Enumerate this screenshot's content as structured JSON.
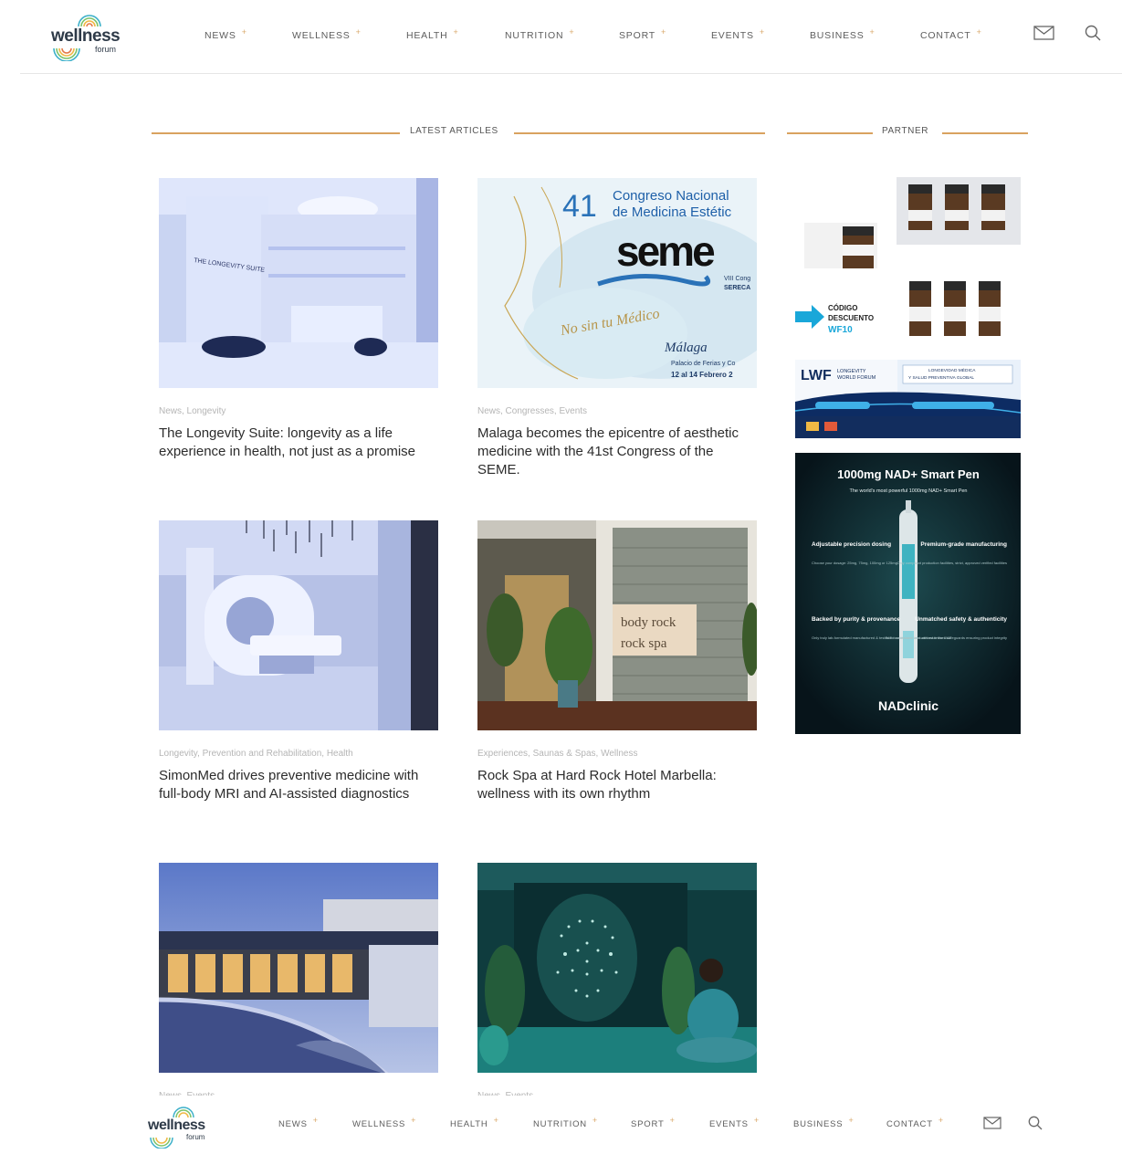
{
  "brand": {
    "name": "wellness",
    "sub": "forum"
  },
  "nav": [
    {
      "label": "NEWS"
    },
    {
      "label": "WELLNESS"
    },
    {
      "label": "HEALTH"
    },
    {
      "label": "NUTRITION"
    },
    {
      "label": "SPORT"
    },
    {
      "label": "EVENTS"
    },
    {
      "label": "BUSINESS"
    },
    {
      "label": "CONTACT"
    }
  ],
  "nav_plus": "+",
  "icons": {
    "mail": "mail-icon",
    "search": "search-icon"
  },
  "sections": {
    "latest": "LATEST ARTICLES",
    "partner": "PARTNER"
  },
  "articles": [
    {
      "categories": "News, Longevity",
      "title": "The Longevity Suite: longevity as a life experience in health, not just as a promise"
    },
    {
      "categories": "News, Congresses, Events",
      "title": "Malaga becomes the epicentre of aesthetic medicine with the 41st Congress of the SEME."
    },
    {
      "categories": "Longevity, Prevention and Rehabilitation, Health",
      "title": "SimonMed drives preventive medicine with full-body MRI and AI-assisted diagnostics"
    },
    {
      "categories": "Experiences, Saunas & Spas, Wellness",
      "title": "Rock Spa at Hard Rock Hotel Marbella: wellness with its own rhythm"
    },
    {
      "categories": "News, Events",
      "title": ""
    },
    {
      "categories": "News, Events",
      "title": ""
    }
  ],
  "thumbs": {
    "suite_sign": "THE LONGEVITY SUITE",
    "seme_number": "41",
    "seme_line1": "Congreso Nacional",
    "seme_line2": "de Medicina Estétic",
    "seme_logo": "seme",
    "seme_side1": "VIII Cong",
    "seme_side2": "SERECA",
    "seme_script": "No sin tu Médico",
    "seme_city": "Málaga",
    "seme_venue": "Palacio de Ferias y Co",
    "seme_dates": "12 al 14 Febrero 2",
    "rock_line1": "body rock",
    "rock_line2": "rock spa"
  },
  "ads": {
    "serum": {
      "code1": "CÓDIGO",
      "code2": "DESCUENTO",
      "code3": "WF10"
    },
    "lwf": {
      "logo": "LWF",
      "logo_sub1": "LONGEVITY",
      "logo_sub2": "WORLD FORUM",
      "tag1": "LONGEVIDAD MÉDICA",
      "tag2": "Y SALUD PREVENTIVA GLOBAL"
    },
    "nad": {
      "title": "1000mg NAD+ Smart Pen",
      "subtitle": "The world's most powerful 1000mg NAD+ Smart Pen",
      "f1_title": "Adjustable precision dosing",
      "f1_body": "Choose your dosage: 25mg, 75mg, 100mg or 125mg",
      "f2_title": "Premium-grade manufacturing",
      "f2_body": "Only compliant production facilities, strict, approved verified facilities",
      "f3_title": "Backed by purity & provenance",
      "f3_body": "Only truly lab-formulated manufactured & tested for acceptable labs ranked in the UAE",
      "f4_title": "Unmatched safety & authenticity",
      "f4_body": "Built to withstand and with maximised safeguards ensuring product integrity",
      "brand": "NADclinic"
    }
  },
  "colors": {
    "accent": "#d9a25f",
    "text": "#2c2c2c",
    "muted": "#b5b5b5",
    "nav": "#5d5d5d"
  }
}
